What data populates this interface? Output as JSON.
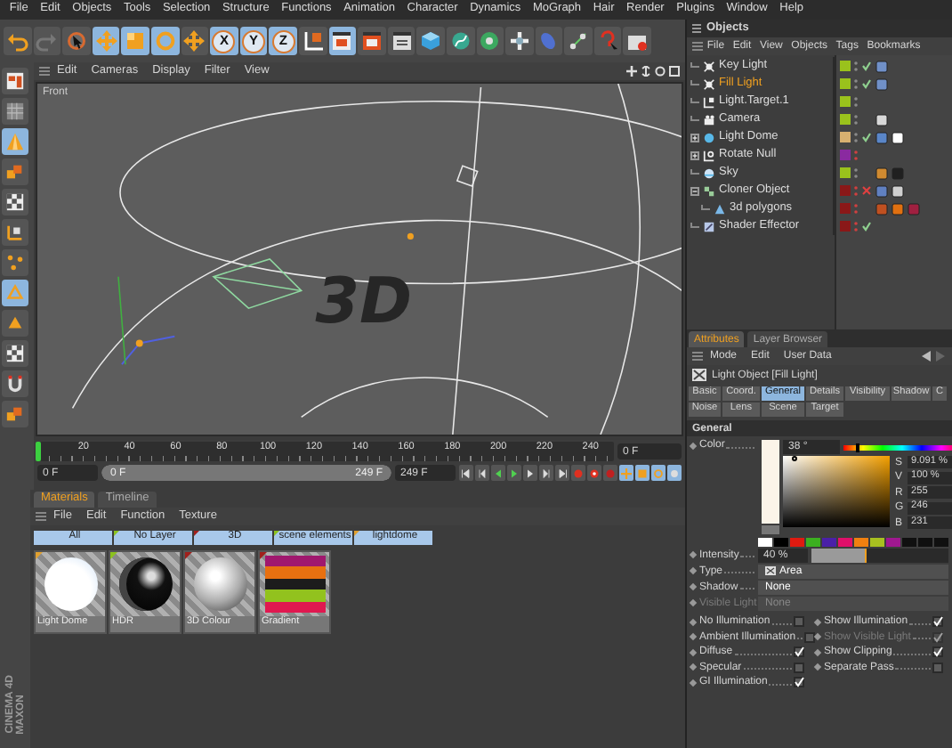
{
  "menu_bar": [
    "File",
    "Edit",
    "Objects",
    "Tools",
    "Selection",
    "Structure",
    "Functions",
    "Animation",
    "Character",
    "Dynamics",
    "MoGraph",
    "Hair",
    "Render",
    "Plugins",
    "Window",
    "Help"
  ],
  "toolbar": {
    "tools": [
      {
        "kind": "undo",
        "selected": false
      },
      {
        "kind": "redo",
        "selected": false
      },
      {
        "kind": "select",
        "selected": false
      },
      {
        "kind": "move",
        "selected": true
      },
      {
        "kind": "scale",
        "selected": true
      },
      {
        "kind": "rotate",
        "selected": true
      },
      {
        "kind": "move",
        "selected": false
      },
      {
        "kind": "axis",
        "label": "X",
        "selected": true
      },
      {
        "kind": "axis",
        "label": "Y",
        "selected": true
      },
      {
        "kind": "axis",
        "label": "Z",
        "selected": true
      },
      {
        "kind": "coords",
        "selected": false
      },
      {
        "kind": "render",
        "selected": true
      },
      {
        "kind": "picture",
        "selected": false
      },
      {
        "kind": "settings",
        "selected": false
      },
      {
        "kind": "cube",
        "selected": false
      },
      {
        "kind": "spline",
        "selected": false
      },
      {
        "kind": "generator",
        "selected": false
      },
      {
        "kind": "array",
        "selected": false
      },
      {
        "kind": "deformer",
        "selected": false
      },
      {
        "kind": "scene",
        "selected": false
      },
      {
        "kind": "help",
        "selected": false
      },
      {
        "kind": "layout",
        "selected": false
      }
    ]
  },
  "left_toolbar": [
    {
      "kind": "panel",
      "selected": false
    },
    {
      "kind": "mesh",
      "selected": false
    },
    {
      "kind": "model",
      "selected": true
    },
    {
      "kind": "object",
      "selected": false
    },
    {
      "kind": "texture",
      "selected": false
    },
    {
      "kind": "gizmo",
      "selected": false
    },
    {
      "kind": "points",
      "selected": false
    },
    {
      "kind": "edges",
      "selected": true
    },
    {
      "kind": "polygons",
      "selected": false
    },
    {
      "kind": "texture",
      "selected": false
    },
    {
      "kind": "snap",
      "selected": false
    },
    {
      "kind": "object",
      "selected": false
    }
  ],
  "viewport": {
    "menu": [
      "Edit",
      "Cameras",
      "Display",
      "Filter",
      "View"
    ],
    "label": "Front",
    "object_text": "3D"
  },
  "timeline": {
    "ticks": [
      "20",
      "40",
      "60",
      "80",
      "100",
      "120",
      "140",
      "160",
      "180",
      "200",
      "220",
      "240"
    ],
    "playhead": {
      "level": 0
    },
    "current_frame": "0 F",
    "start": "0 F",
    "range": {
      "start": "0 F",
      "end": "249 F",
      "level": 1
    },
    "end": "249 F"
  },
  "logo": [
    "MAXON",
    "CINEMA 4D"
  ],
  "materials": {
    "tabs": [
      {
        "label": "Materials",
        "selected": true
      },
      {
        "label": "Timeline",
        "selected": false
      }
    ],
    "menu": [
      "File",
      "Edit",
      "Function",
      "Texture"
    ],
    "layers": [
      {
        "label": "All"
      },
      {
        "label": "No Layer",
        "color": "#8cc21e"
      },
      {
        "label": "3D",
        "color": "#a0201c"
      },
      {
        "label": "scene elements",
        "color": "#8cc21e"
      },
      {
        "label": "lightdome",
        "color": "#e0a030"
      }
    ],
    "items": [
      {
        "name": "Light Dome",
        "kind": "light",
        "color": "#e0a030"
      },
      {
        "name": "HDR",
        "kind": "hdr",
        "color": "#8cc21e"
      },
      {
        "name": "3D Colour",
        "kind": "grey",
        "color": "#a0201c"
      },
      {
        "name": "Gradient",
        "kind": "gradient",
        "color": "#a0201c"
      }
    ]
  },
  "objects": {
    "title": "Objects",
    "menu": [
      "File",
      "Edit",
      "View",
      "Objects",
      "Tags",
      "Bookmarks"
    ],
    "items": [
      {
        "name": "Key Light",
        "kind": "light",
        "selected": false,
        "color": "#9ac21c",
        "hidden": false,
        "enabled": true,
        "tags": [
          {
            "color": "#7090c8"
          }
        ]
      },
      {
        "name": "Fill Light",
        "kind": "light",
        "selected": true,
        "color": "#9ac21c",
        "hidden": false,
        "enabled": true,
        "tags": [
          {
            "color": "#7090c8"
          }
        ]
      },
      {
        "name": "Light.Target.1",
        "kind": "target",
        "selected": false,
        "color": "#9ac21c",
        "hidden": false
      },
      {
        "name": "Camera",
        "kind": "camera",
        "selected": false,
        "color": "#9ac21c",
        "hidden": false,
        "tags": [
          {
            "color": "#d8d8d8"
          }
        ]
      },
      {
        "name": "Light Dome",
        "kind": "dome",
        "selected": false,
        "expanded": false,
        "color": "#d8b070",
        "hidden": false,
        "enabled": true,
        "tags": [
          {
            "color": "#5a86c8"
          },
          {
            "color": "#ffffff"
          }
        ]
      },
      {
        "name": "Rotate Null",
        "kind": "null",
        "selected": false,
        "expanded": false,
        "color": "#8a2aa0",
        "hidden": true
      },
      {
        "name": "Sky",
        "kind": "sky",
        "selected": false,
        "color": "#9ac21c",
        "hidden": false,
        "tags": [
          {
            "color": "#d08a30"
          },
          {
            "color": "#202020"
          }
        ]
      },
      {
        "name": "Cloner Object",
        "kind": "cloner",
        "selected": false,
        "expanded": true,
        "color": "#8a1818",
        "hidden": true,
        "enabled": false,
        "tags": [
          {
            "color": "#6080c0"
          },
          {
            "color": "#d0d0d0"
          }
        ],
        "children": [
          {
            "name": "3d polygons",
            "kind": "polygon",
            "selected": false,
            "color": "#8a1818",
            "hidden": true,
            "tags": [
              {
                "color": "#c05020"
              },
              {
                "color": "#e07010"
              },
              {
                "color": "#a02040"
              }
            ]
          }
        ]
      },
      {
        "name": "Shader Effector",
        "kind": "effector",
        "selected": false,
        "color": "#8a1818",
        "hidden": true,
        "enabled": true
      }
    ]
  },
  "attributes": {
    "tabs": [
      {
        "label": "Attributes",
        "selected": true
      },
      {
        "label": "Layer Browser",
        "selected": false
      }
    ],
    "menu": [
      "Mode",
      "Edit",
      "User Data"
    ],
    "object_title": "Light Object [Fill Light]",
    "property_tabs": [
      [
        {
          "label": "Basic",
          "selected": false
        },
        {
          "label": "Coord.",
          "selected": false
        },
        {
          "label": "General",
          "selected": true
        },
        {
          "label": "Details",
          "selected": false
        },
        {
          "label": "Visibility",
          "selected": false
        },
        {
          "label": "Shadow",
          "selected": false
        },
        {
          "label": "C",
          "selected": false
        }
      ],
      [
        {
          "label": "Noise",
          "selected": false
        },
        {
          "label": "Lens",
          "selected": false
        },
        {
          "label": "Scene",
          "selected": false
        },
        {
          "label": "Target",
          "selected": false
        }
      ]
    ],
    "group_title": "General",
    "color": {
      "label": "Color",
      "hue": {
        "value": "38 °",
        "level": 0.1
      },
      "fields": [
        {
          "label": "S",
          "value": "9.091 %"
        },
        {
          "label": "V",
          "value": "100 %"
        },
        {
          "label": "R",
          "value": "255"
        },
        {
          "label": "G",
          "value": "246"
        },
        {
          "label": "B",
          "value": "231"
        }
      ],
      "swatches": [
        {
          "color": "#ffffff"
        },
        {
          "color": "#000000"
        },
        {
          "color": "#e01a10"
        },
        {
          "color": "#3cb020"
        },
        {
          "color": "#4a20a8"
        },
        {
          "color": "#e0106a"
        },
        {
          "color": "#f08010"
        },
        {
          "color": "#a8c020"
        },
        {
          "color": "#a01890"
        },
        {
          "color": "#101010"
        },
        {
          "color": "#101010"
        },
        {
          "color": "#101010"
        }
      ]
    },
    "intensity": {
      "label": "Intensity",
      "value": "40 %",
      "level": 0.4
    },
    "fields": [
      {
        "label": "Type",
        "value": "Area",
        "kind": "light-type",
        "disabled": false
      },
      {
        "label": "Shadow",
        "value": "None",
        "kind": "dropdown",
        "disabled": false
      },
      {
        "label": "Visible Light",
        "value": "None",
        "kind": "dropdown",
        "disabled": true
      }
    ],
    "checks": {
      "left": [
        {
          "label": "No Illumination",
          "checked": false,
          "disabled": false
        },
        {
          "label": "Ambient Illumination",
          "checked": false,
          "disabled": false
        },
        {
          "label": "Diffuse",
          "checked": true,
          "disabled": false
        },
        {
          "label": "Specular",
          "checked": false,
          "disabled": false
        },
        {
          "label": "GI Illumination",
          "checked": true,
          "disabled": false
        }
      ],
      "right": [
        {
          "label": "Show Illumination",
          "checked": true,
          "disabled": false
        },
        {
          "label": "Show Visible Light",
          "checked": true,
          "disabled": true
        },
        {
          "label": "Show Clipping",
          "checked": true,
          "disabled": false
        },
        {
          "label": "Separate Pass",
          "checked": false,
          "disabled": false
        }
      ]
    }
  }
}
